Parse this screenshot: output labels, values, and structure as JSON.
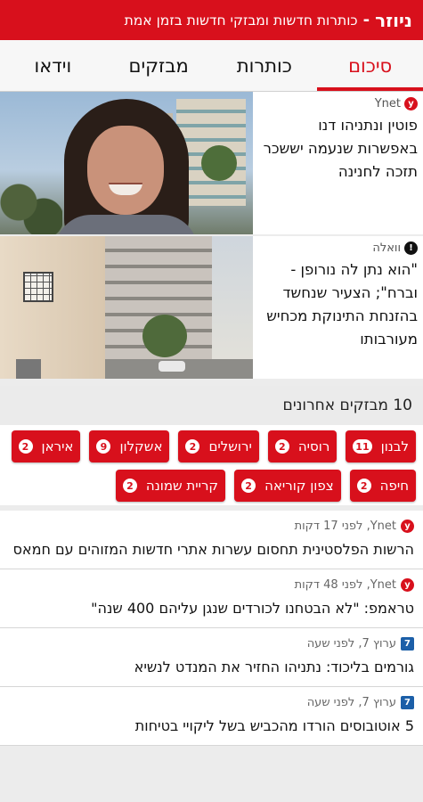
{
  "header": {
    "brand": "ניוזר",
    "separator": "-",
    "tagline": "כותרות חדשות ומבזקי חדשות בזמן אמת"
  },
  "tabs": [
    {
      "label": "סיכום",
      "active": true
    },
    {
      "label": "כותרות",
      "active": false
    },
    {
      "label": "מבזקים",
      "active": false
    },
    {
      "label": "וידאו",
      "active": false
    }
  ],
  "articles": [
    {
      "source": "Ynet",
      "source_icon": "ynet-logo-icon",
      "headline": "פוטין ונתניהו דנו באפשרות שנעמה יששכר תזכה לחנינה"
    },
    {
      "source": "וואלה",
      "source_icon": "walla-logo-icon",
      "headline": "\"הוא נתן לה נורופן - וברח\"; הצעיר שנחשד בהזנחת התינוקת מכחיש מעורבותו"
    }
  ],
  "flash_section": {
    "title": "10 מבזקים אחרונים",
    "tags": [
      {
        "label": "לבנון",
        "count": "11"
      },
      {
        "label": "רוסיה",
        "count": "2"
      },
      {
        "label": "ירושלים",
        "count": "2"
      },
      {
        "label": "אשקלון",
        "count": "9"
      },
      {
        "label": "איראן",
        "count": "2"
      },
      {
        "label": "חיפה",
        "count": "2"
      },
      {
        "label": "צפון קוריאה",
        "count": "2"
      },
      {
        "label": "קריית שמונה",
        "count": "2"
      }
    ]
  },
  "alerts": [
    {
      "source": "Ynet",
      "time": "לפני 17 דקות",
      "source_icon": "ynet-logo-icon",
      "text": "הרשות הפלסטינית תחסום עשרות אתרי חדשות המזוהים עם חמאס"
    },
    {
      "source": "Ynet",
      "time": "לפני 48 דקות",
      "source_icon": "ynet-logo-icon",
      "text": "טראמפ: \"לא הבטחנו לכורדים שנגן עליהם 400 שנה\""
    },
    {
      "source": "ערוץ 7",
      "time": "לפני שעה",
      "source_icon": "arutz7-logo-icon",
      "text": "גורמים בליכוד: נתניהו החזיר את המנדט לנשיא"
    },
    {
      "source": "ערוץ 7",
      "time": "לפני שעה",
      "source_icon": "arutz7-logo-icon",
      "text": "5 אוטובוסים הורדו מהכביש בשל ליקויי בטיחות"
    }
  ],
  "colors": {
    "brand_red": "#d8101c",
    "background": "#ececec"
  }
}
